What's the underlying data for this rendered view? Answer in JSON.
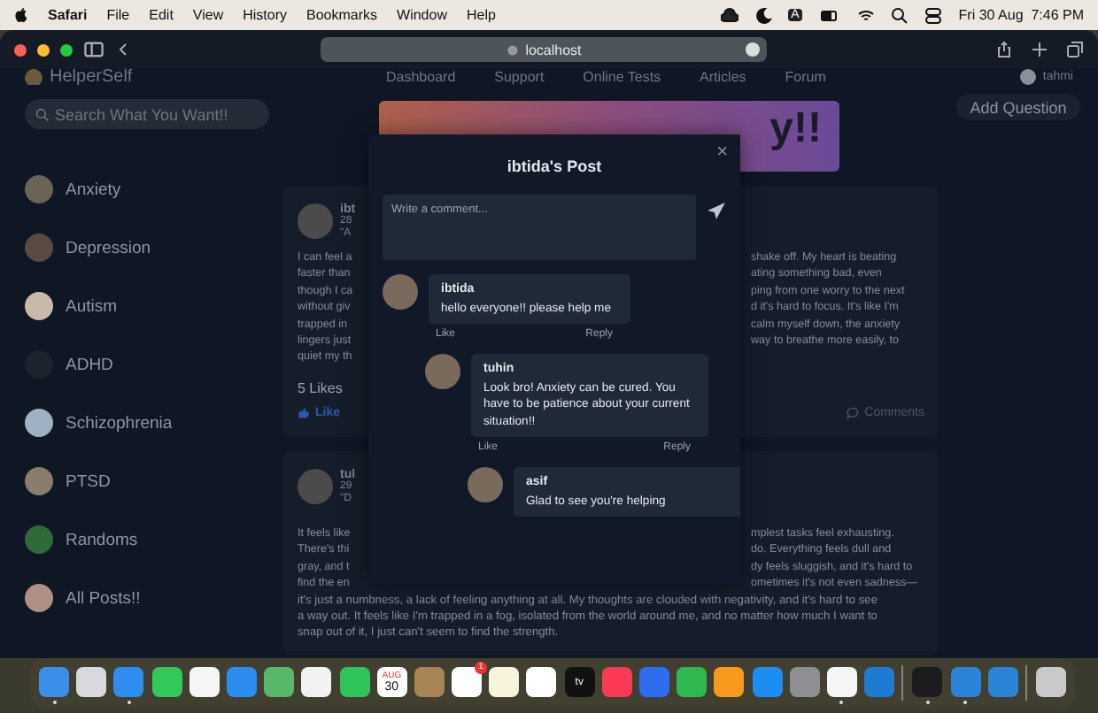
{
  "menu_bar": {
    "app": "Safari",
    "items": [
      "File",
      "Edit",
      "View",
      "History",
      "Bookmarks",
      "Window",
      "Help"
    ],
    "input_badge": "A",
    "clock": "Fri 30 Aug  7:46 PM"
  },
  "browser": {
    "url": "localhost"
  },
  "site_header": {
    "logo": "HelperSelf",
    "nav": [
      "Dashboard",
      "Support",
      "Online Tests",
      "Articles",
      "Forum"
    ],
    "user": "tahmi"
  },
  "sidebar": {
    "search": {
      "placeholder": "Search What You Want!!"
    },
    "categories": [
      {
        "label": "Anxiety",
        "color": "#6b6258"
      },
      {
        "label": "Depression",
        "color": "#5a4a44"
      },
      {
        "label": "Autism",
        "color": "#c9b9a8"
      },
      {
        "label": "ADHD",
        "color": "#1d232c"
      },
      {
        "label": "Schizophrenia",
        "color": "#9fb2c4"
      },
      {
        "label": "PTSD",
        "color": "#8a7d6e"
      },
      {
        "label": "Randoms",
        "color": "#2e6a3a"
      },
      {
        "label": "All Posts!!",
        "color": "#b08f86"
      }
    ]
  },
  "banner": {
    "title": "y!!"
  },
  "add_question": "Add Question",
  "posts": [
    {
      "author": "ibt",
      "date": "28",
      "quote": "\"A",
      "left": [
        "I can feel a",
        "faster than",
        "though I ca",
        "without giv",
        "trapped in",
        "lingers just",
        "quiet my th"
      ],
      "right": [
        "shake off. My heart is beating",
        "ating something bad, even",
        "ping from one worry to the next",
        "d it's hard to focus. It's like I'm",
        "calm myself down, the anxiety",
        "way to breathe more easily, to"
      ],
      "likes": "5 Likes",
      "like": "Like",
      "comments": "Comments"
    },
    {
      "author": "tul",
      "date": "29",
      "quote": "\"D",
      "left": [
        "It feels like",
        "There's thi",
        "gray, and t",
        "find the en"
      ],
      "right": [
        "mplest tasks feel exhausting.",
        "do. Everything feels dull and",
        "dy feels sluggish, and it's hard to",
        "ometimes it's not even sadness—"
      ],
      "full": [
        "it's just a numbness, a lack of feeling anything at all. My thoughts are clouded with negativity, and it's hard to see",
        "a way out. It feels like I'm trapped in a fog, isolated from the world around me, and no matter how much I want to",
        "snap out of it, I just can't seem to find the strength."
      ]
    }
  ],
  "modal": {
    "title": "ibtida's Post",
    "close": "×",
    "comment_field": {
      "placeholder": "Write a comment..."
    },
    "comments": [
      {
        "author": "ibtida",
        "text": "hello everyone!! please help me",
        "like": "Like",
        "reply": "Reply",
        "children": [
          {
            "author": "tuhin",
            "text": "Look bro! Anxiety can be cured. You have to be patience about your current situation!!",
            "like": "Like",
            "reply": "Reply",
            "children": [
              {
                "author": "asif",
                "text": "Glad to see you're helping"
              }
            ]
          }
        ]
      }
    ]
  },
  "dock": [
    {
      "color": "#3b8fe8",
      "open": true
    },
    {
      "color": "#d8d8de",
      "open": false
    },
    {
      "color": "#2f8cf0",
      "open": true
    },
    {
      "color": "#34c759",
      "open": false
    },
    {
      "color": "#f5f5f5",
      "open": false
    },
    {
      "color": "#2d8cf0",
      "open": false
    },
    {
      "color": "#58b86a",
      "open": false
    },
    {
      "color": "#f2f2f2",
      "open": false
    },
    {
      "color": "#30c35a",
      "open": false
    },
    {
      "color": "#ffffff",
      "open": false,
      "label": "30",
      "top": "AUG"
    },
    {
      "color": "#a78455",
      "open": false
    },
    {
      "color": "#ffffff",
      "open": false,
      "badge": "1"
    },
    {
      "color": "#f7f3dc",
      "open": false
    },
    {
      "color": "#ffffff",
      "open": false
    },
    {
      "color": "#111111",
      "open": false,
      "label": "tv"
    },
    {
      "color": "#fa3a55",
      "open": false
    },
    {
      "color": "#2d6df0",
      "open": false
    },
    {
      "color": "#2fb84f",
      "open": false
    },
    {
      "color": "#f79a1e",
      "open": false
    },
    {
      "color": "#1c8ef2",
      "open": false
    },
    {
      "color": "#8e8e93",
      "open": false
    },
    {
      "color": "#f5f5f5",
      "open": true
    },
    {
      "color": "#1f7ad1",
      "open": false
    },
    {
      "color": "#1c1c1e",
      "open": true,
      "sep": true
    },
    {
      "color": "#2b84d8",
      "open": true
    },
    {
      "color": "#2b84d8",
      "open": false
    },
    {
      "color": "#c9c9cc",
      "open": false,
      "sep": true
    }
  ]
}
